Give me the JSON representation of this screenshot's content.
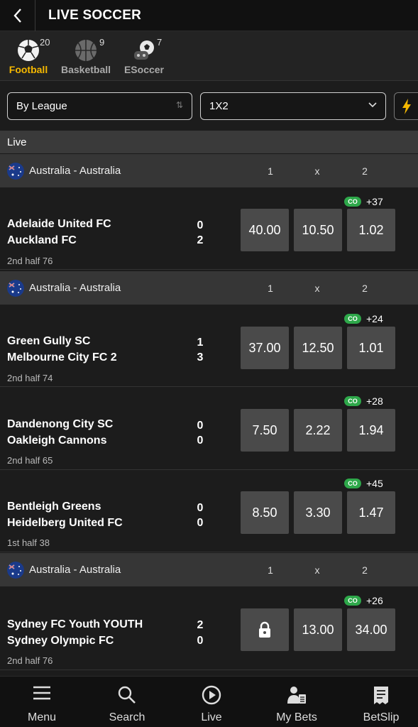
{
  "header": {
    "title": "LIVE SOCCER"
  },
  "sports": [
    {
      "label": "Football",
      "count": "20"
    },
    {
      "label": "Basketball",
      "count": "9"
    },
    {
      "label": "ESoccer",
      "count": "7"
    }
  ],
  "filters": {
    "league": "By League",
    "market": "1X2"
  },
  "section": {
    "live": "Live"
  },
  "league_name": "Australia -  Australia",
  "cols": {
    "c1": "1",
    "cx": "x",
    "c2": "2"
  },
  "co_label": "CO",
  "matches": [
    {
      "home": "Adelaide United FC",
      "away": "Auckland FC",
      "home_score": "0",
      "away_score": "2",
      "time": "2nd half 76",
      "odds": [
        "40.00",
        "10.50",
        "1.02"
      ],
      "more": "+37"
    },
    {
      "home": "Green Gully SC",
      "away": "Melbourne City FC 2",
      "home_score": "1",
      "away_score": "3",
      "time": "2nd half 74",
      "odds": [
        "37.00",
        "12.50",
        "1.01"
      ],
      "more": "+24"
    },
    {
      "home": "Dandenong City SC",
      "away": "Oakleigh Cannons",
      "home_score": "0",
      "away_score": "0",
      "time": "2nd half 65",
      "odds": [
        "7.50",
        "2.22",
        "1.94"
      ],
      "more": "+28"
    },
    {
      "home": "Bentleigh Greens",
      "away": "Heidelberg United FC",
      "home_score": "0",
      "away_score": "0",
      "time": "1st half 38",
      "odds": [
        "8.50",
        "3.30",
        "1.47"
      ],
      "more": "+45"
    },
    {
      "home": "Sydney FC Youth YOUTH",
      "away": "Sydney Olympic FC",
      "home_score": "2",
      "away_score": "0",
      "time": "2nd half 76",
      "odds": [
        "",
        "13.00",
        "34.00"
      ],
      "more": "+26",
      "locked_home": true
    }
  ],
  "bottom_nav": [
    {
      "label": "Menu",
      "icon": "menu-icon"
    },
    {
      "label": "Search",
      "icon": "search-icon"
    },
    {
      "label": "Live",
      "icon": "play-icon"
    },
    {
      "label": "My Bets",
      "icon": "mybets-icon"
    },
    {
      "label": "BetSlip",
      "icon": "betslip-icon"
    }
  ],
  "colors": {
    "accent": "#f5b800",
    "co_badge": "#2ea84a",
    "odd_bg": "#4a4a4a"
  }
}
